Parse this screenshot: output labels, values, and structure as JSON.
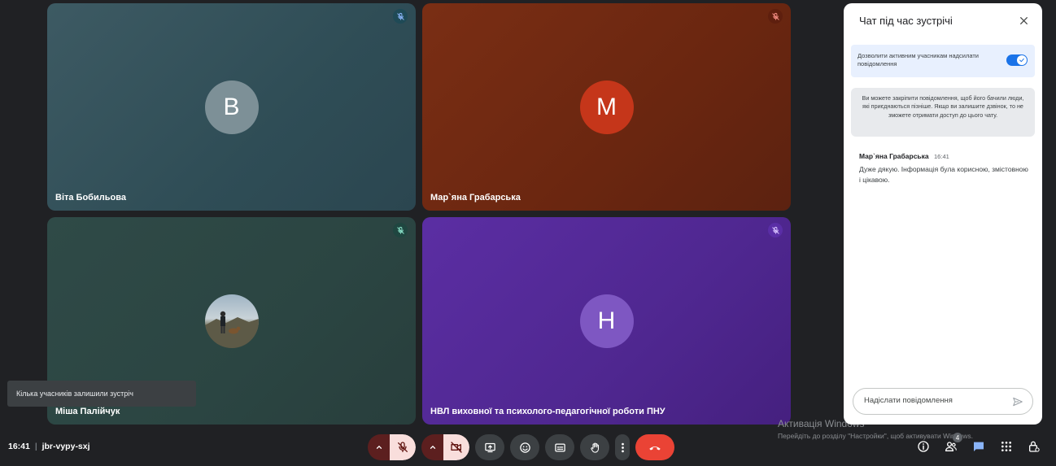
{
  "tiles": [
    {
      "name": "Віта Бобильова",
      "initial": "B",
      "avatar_color": "#7d9097",
      "mic_badge_color": "#1f4a56"
    },
    {
      "name": "Мар`яна Грабарська",
      "initial": "M",
      "avatar_color": "#c5361a",
      "mic_badge_color": "#5e1f0e"
    },
    {
      "name": "Міша Палійчук",
      "initial": "",
      "avatar_color": "#7b8f9a",
      "mic_badge_color": "#1f4640"
    },
    {
      "name": "НВЛ виховної та психолого-педагогічної роботи ПНУ",
      "initial": "H",
      "avatar_color": "#7e57c2",
      "mic_badge_color": "#5a2ea6"
    }
  ],
  "toast": {
    "text": "Кілька учасників залишили зустріч"
  },
  "meeting": {
    "time": "16:41",
    "separator": "|",
    "code": "jbr-vypy-sxj"
  },
  "controls": {
    "mic": {
      "state": "off",
      "icon": "mic-off-icon"
    },
    "camera": {
      "state": "off",
      "icon": "camera-off-icon"
    },
    "present": {
      "icon": "present-icon"
    },
    "emoji": {
      "icon": "emoji-icon"
    },
    "captions": {
      "icon": "captions-icon"
    },
    "hand": {
      "icon": "raise-hand-icon"
    },
    "more": {
      "icon": "more-vert-icon"
    },
    "end": {
      "icon": "end-call-icon",
      "color": "#ea4335"
    }
  },
  "right_icons": {
    "info": "info-icon",
    "people": "people-icon",
    "people_count": "4",
    "chat": "chat-icon",
    "apps": "apps-icon",
    "host": "host-controls-icon"
  },
  "activation": {
    "title": "Активація Windows",
    "subtitle": "Перейдіть до розділу \"Настройки\", щоб активувати Windows."
  },
  "chat": {
    "title": "Чат під час зустрічі",
    "toggle_label": "Дозволити активним учасникам надсилати повідомлення",
    "toggle_on": true,
    "pin_note": "Ви можете закріпити повідомлення, щоб його бачили люди, які приєднаються пізніше. Якщо ви залишите дзвінок, то не зможете отримати доступ до цього чату.",
    "messages": [
      {
        "sender": "Мар`яна Грабарська",
        "time": "16:41",
        "text": "Дуже дякую. Інформація була корисною, змістовною і цікавою."
      }
    ],
    "input_placeholder": "Надіслати повідомлення"
  }
}
